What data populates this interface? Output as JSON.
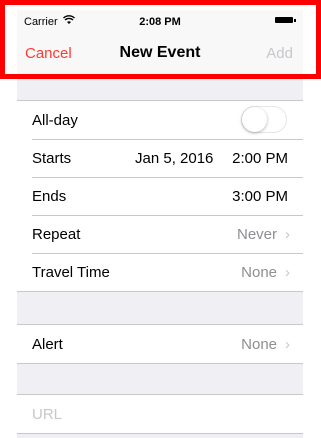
{
  "status": {
    "carrier": "Carrier",
    "time": "2:08 PM"
  },
  "nav": {
    "cancel": "Cancel",
    "title": "New Event",
    "add": "Add"
  },
  "rows": {
    "allday": {
      "label": "All-day",
      "on": false
    },
    "starts": {
      "label": "Starts",
      "date": "Jan 5, 2016",
      "time": "2:00 PM"
    },
    "ends": {
      "label": "Ends",
      "time": "3:00 PM"
    },
    "repeat": {
      "label": "Repeat",
      "value": "Never"
    },
    "travel": {
      "label": "Travel Time",
      "value": "None"
    },
    "alert": {
      "label": "Alert",
      "value": "None"
    },
    "url": {
      "placeholder": "URL"
    }
  },
  "colors": {
    "accent": "#ff3b30",
    "highlight": "#ff0000"
  },
  "icons": {
    "chevron": "chevron-right-icon",
    "wifi": "wifi-icon",
    "battery": "battery-icon"
  }
}
